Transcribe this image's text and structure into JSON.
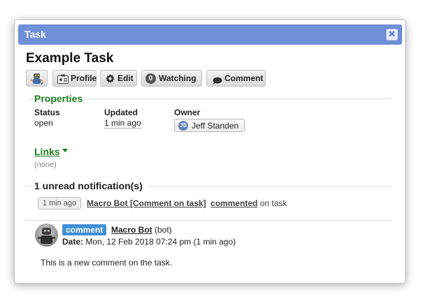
{
  "dialog": {
    "title": "Task",
    "close_glyph": "✖"
  },
  "task": {
    "title": "Example Task"
  },
  "toolbar": {
    "avatar_icon": "robot-avatar-icon",
    "profile_label": "Profile",
    "edit_label": "Edit",
    "watching_count": "0",
    "watching_label": "Watching",
    "comment_label": "Comment"
  },
  "properties": {
    "title": "Properties",
    "status_label": "Status",
    "status_value": "open",
    "updated_label": "Updated",
    "updated_value": "1 min ago",
    "owner_label": "Owner",
    "owner_initials": "JS",
    "owner_name": "Jeff Standen"
  },
  "links": {
    "title": "Links",
    "empty_text": "(none)"
  },
  "notifications": {
    "title": "1 unread notification(s)",
    "items": [
      {
        "time": "1 min ago",
        "actor": "Macro Bot [Comment on task]",
        "verb": "commented",
        "suffix": " on task"
      }
    ]
  },
  "comment": {
    "tag": "comment",
    "author": "Macro Bot",
    "author_suffix": " (bot)",
    "date_label": "Date:",
    "date_value": " Mon, 12 Feb 2018 07:24 pm (1 min ago)",
    "body": "This is a new comment on the task."
  },
  "colors": {
    "titlebar": "#6f8fd8",
    "section_green": "#1a7f1a",
    "comment_tag": "#3f8fd6",
    "owner_avatar": "#5d82b6"
  }
}
